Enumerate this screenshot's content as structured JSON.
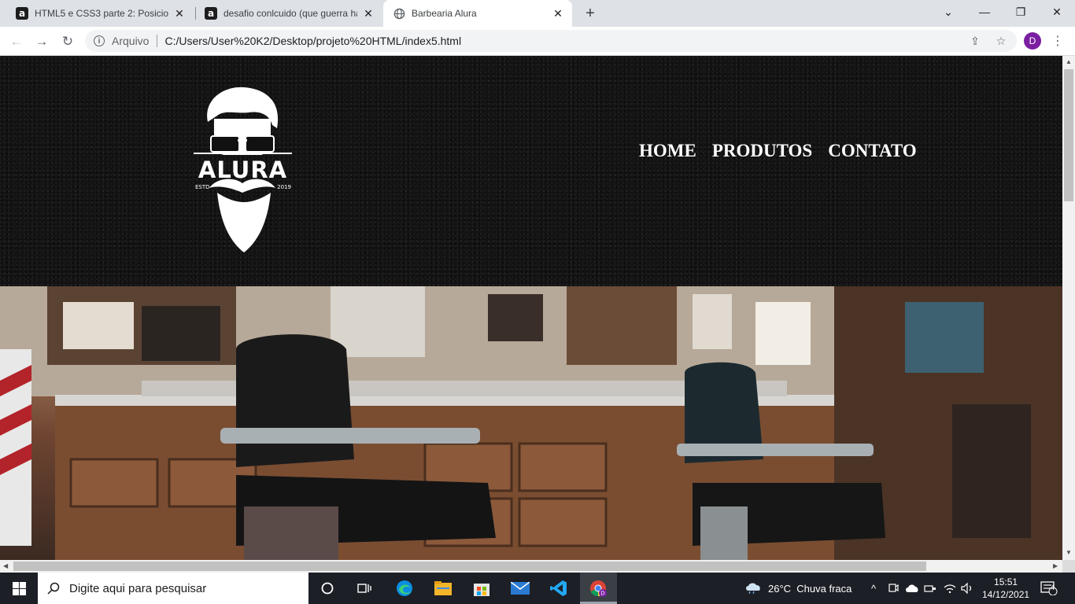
{
  "browser": {
    "tabs": [
      {
        "favicon": "a",
        "title": "HTML5 e CSS3 parte 2: Posiciona",
        "active": false
      },
      {
        "favicon": "a",
        "title": "desafio conlcuido (que guerra ha",
        "active": false
      },
      {
        "favicon": "globe-icon",
        "title": "Barbearia Alura",
        "active": true
      }
    ],
    "address_protocol": "Arquivo",
    "address_url": "C:/Users/User%20K2/Desktop/projeto%20HTML/index5.html",
    "profile_initial": "D"
  },
  "site": {
    "logo": {
      "brand": "ALURA",
      "estd": "ESTD",
      "year": "2019"
    },
    "nav": [
      "HOME",
      "PRODUTOS",
      "CONTATO"
    ]
  },
  "taskbar": {
    "search_placeholder": "Digite aqui para pesquisar",
    "weather": "26°C  Chuva fraca",
    "time": "15:51",
    "date": "14/12/2021",
    "notifications": "4"
  }
}
